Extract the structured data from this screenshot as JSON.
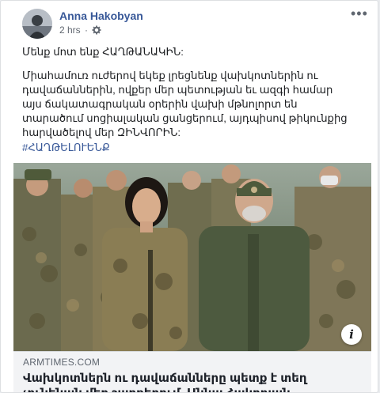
{
  "post": {
    "author": "Anna Hakobyan",
    "time": "2 hrs",
    "separator": "·",
    "privacy_icon": "gear-icon",
    "more_icon": "more-options-icon",
    "text_line1": "Մենք մոտ ենք ՀԱՂԹԱՆԱԿԻՆ:",
    "text_paragraph": "Միահամուռ ուժերով եկեք լրեցնենք վախկոտներին ու դավաճաններին, ովքեր մեր պետության եւ ազգի համար այս ճակատագրական օրերին վախի մթնոլորտ են տարածում սոցիալական ցանցերում, այդպիսով թիկունքից հարվածելով մեր ԶԻՆՎՈՐԻՆ:",
    "hashtag": "#ՀԱՂԹԵԼՈՒԵՆՔ"
  },
  "link_preview": {
    "domain": "ARMTIMES.COM",
    "title": "Վախկոտներն ու դավաճանները պետք է տեղ չունենան մեր շարքերում. Աննա Հակոբյան",
    "info_label": "i"
  },
  "colors": {
    "link_blue": "#385898",
    "text_dark": "#1c1e21",
    "meta_gray": "#606770",
    "link_box_bg": "#f2f3f5"
  }
}
